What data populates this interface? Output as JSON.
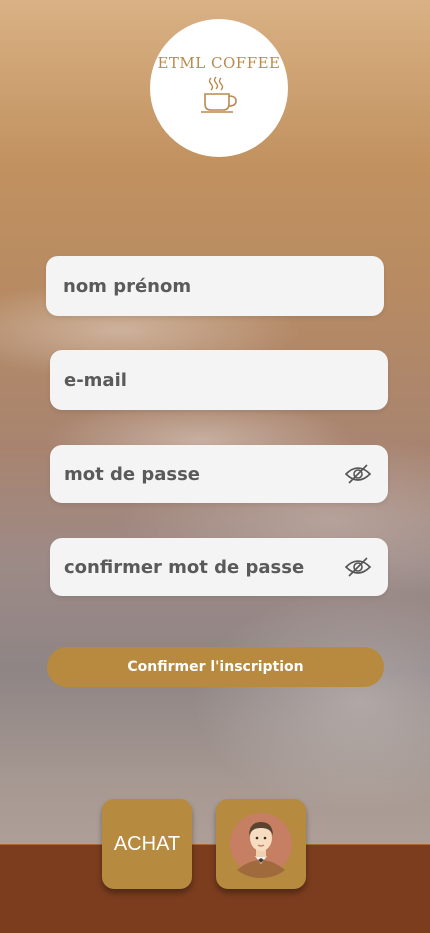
{
  "logo": {
    "text": "ETML COFFEE",
    "icon": "coffee-cup-icon"
  },
  "form": {
    "name_placeholder": "nom prénom",
    "email_placeholder": "e-mail",
    "password_placeholder": "mot de passe",
    "confirm_password_placeholder": "confirmer mot de passe",
    "submit_label": "Confirmer l'inscription"
  },
  "nav": {
    "achat_label": "ACHAT",
    "profile_icon": "user-avatar-icon"
  },
  "colors": {
    "accent": "#b78a3f",
    "bottom_bar": "#7b3d1e",
    "field_bg": "#f4f4f4",
    "logo_text": "#b98a4d"
  }
}
